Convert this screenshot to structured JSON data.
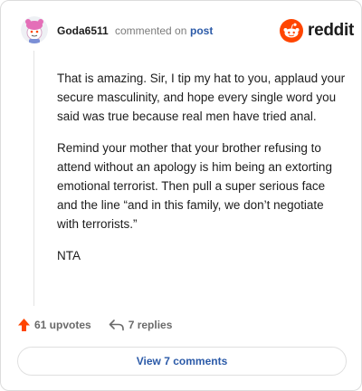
{
  "header": {
    "username": "Goda6511",
    "connector": "commented on",
    "post_link": "post",
    "logo_text": "reddit"
  },
  "comment": {
    "paragraphs": [
      "That is amazing. Sir, I tip my hat to you, applaud your secure masculinity, and hope every single word you said was true because real men have tried anal.",
      "Remind your mother that your brother refusing to attend without an apology is him being an extorting emotional terrorist. Then pull a super serious face and the line “and in this family, we don’t negotiate with terrorists.”",
      "NTA"
    ]
  },
  "actions": {
    "upvotes": "61 upvotes",
    "replies": "7 replies"
  },
  "view_button": "View 7 comments",
  "colors": {
    "upvote": "#ff4500",
    "link": "#2b5aa8",
    "brand": "#ff4500"
  },
  "icons": {
    "avatar": "pink-snoo-avatar",
    "logo": "reddit-snoo-logo",
    "upvote": "upvote-arrow-icon",
    "reply": "reply-arrow-icon"
  }
}
